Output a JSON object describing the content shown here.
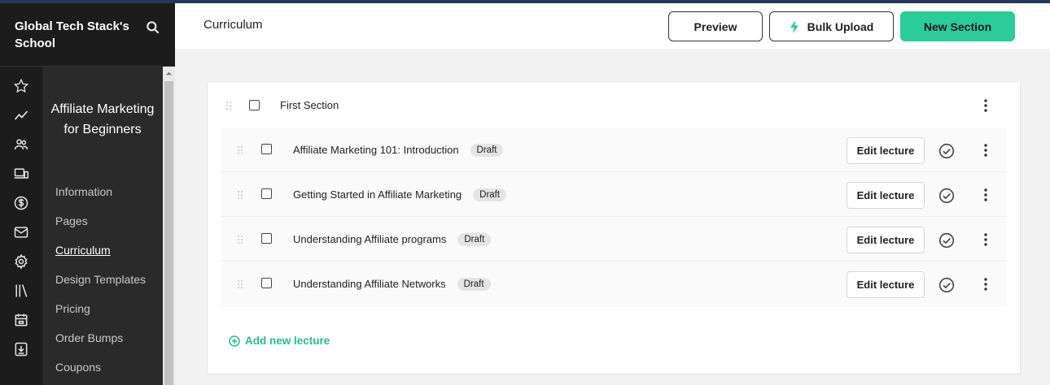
{
  "school": {
    "name": "Global Tech Stack's School"
  },
  "rail_icons": [
    "star-icon",
    "analytics-icon",
    "users-icon",
    "devices-icon",
    "dollar-icon",
    "mail-icon",
    "gear-icon",
    "library-icon",
    "calendar-icon",
    "download-icon"
  ],
  "course": {
    "title": "Affiliate Marketing for Beginners",
    "nav": [
      {
        "label": "Information",
        "active": false
      },
      {
        "label": "Pages",
        "active": false
      },
      {
        "label": "Curriculum",
        "active": true
      },
      {
        "label": "Design Templates",
        "active": false
      },
      {
        "label": "Pricing",
        "active": false
      },
      {
        "label": "Order Bumps",
        "active": false
      },
      {
        "label": "Coupons",
        "active": false
      }
    ]
  },
  "header": {
    "title": "Curriculum",
    "preview_label": "Preview",
    "bulk_upload_label": "Bulk Upload",
    "new_section_label": "New Section"
  },
  "section": {
    "title": "First Section",
    "lectures": [
      {
        "title": "Affiliate Marketing 101: Introduction",
        "status": "Draft",
        "edit_label": "Edit lecture"
      },
      {
        "title": "Getting Started in Affiliate Marketing",
        "status": "Draft",
        "edit_label": "Edit lecture"
      },
      {
        "title": "Understanding Affiliate programs",
        "status": "Draft",
        "edit_label": "Edit lecture"
      },
      {
        "title": "Understanding Affiliate Networks",
        "status": "Draft",
        "edit_label": "Edit lecture"
      }
    ],
    "add_lecture_label": "Add new lecture"
  },
  "colors": {
    "accent": "#2bcb9a",
    "sidebar": "#1c1c1c",
    "topline": "#253858"
  }
}
